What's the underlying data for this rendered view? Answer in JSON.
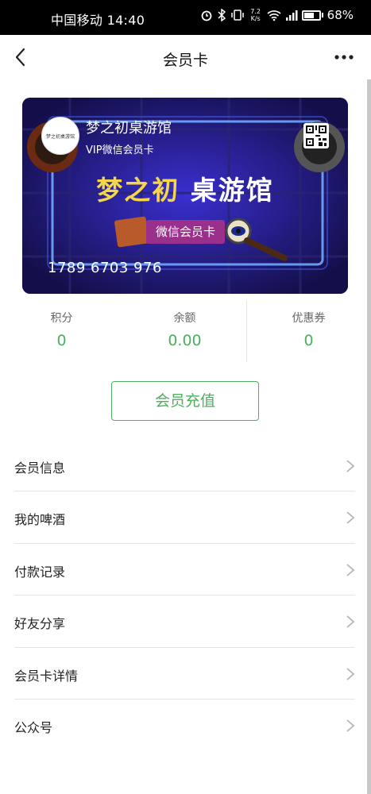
{
  "status_bar": {
    "carrier_time": "中国移动 14:40",
    "net_speed_value": "7.2",
    "net_speed_unit": "K/s",
    "battery": "68%"
  },
  "nav": {
    "title": "会员卡"
  },
  "card": {
    "store_name": "梦之初桌游馆",
    "level": "VIP微信会员卡",
    "banner_part1": "梦之初",
    "banner_part2": " 桌游馆",
    "ribbon": "微信会员卡",
    "card_number": "1789 6703 976",
    "logo_text": "梦之初桌游馆"
  },
  "stats": [
    {
      "label": "积分",
      "value": "0"
    },
    {
      "label": "余额",
      "value": "0.00"
    },
    {
      "label": "优惠券",
      "value": "0"
    }
  ],
  "recharge_label": "会员充值",
  "menu": [
    {
      "label": "会员信息"
    },
    {
      "label": "我的啤酒"
    },
    {
      "label": "付款记录"
    },
    {
      "label": "好友分享"
    },
    {
      "label": "会员卡详情"
    },
    {
      "label": "公众号"
    }
  ],
  "colors": {
    "accent_green": "#4fae5e",
    "card_bg": "#1a1560",
    "ribbon": "#9b2f8c",
    "banner_yellow": "#f3d64a"
  }
}
